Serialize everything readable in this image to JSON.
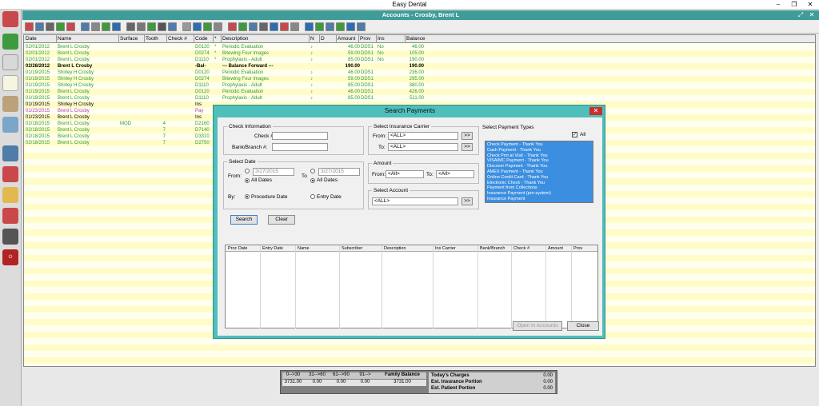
{
  "window": {
    "title": "Easy Dental",
    "controls": [
      "–",
      "❐",
      "✕"
    ]
  },
  "subwindow": {
    "title": "Accounts - Crosby, Brent L",
    "controls": [
      "⤢",
      "✕"
    ]
  },
  "ledger": {
    "columns": [
      "Date",
      "Name",
      "Surface",
      "Tooth",
      "Check #",
      "Code",
      "*",
      "Description",
      "N",
      "D",
      "Amount",
      "Prov",
      "Ins",
      "Balance"
    ],
    "rows": [
      {
        "date": "02/01/2012",
        "name": "Brent L Crosby",
        "surface": "",
        "tooth": "",
        "check": "",
        "code": "D0120",
        "star": "*",
        "desc": "Periodic Evaluation",
        "nd": "♪",
        "amount": "46.00",
        "prov": "DDS1",
        "ins": "No",
        "balance": "46.00",
        "color": "#2d9a3c"
      },
      {
        "date": "02/01/2012",
        "name": "Brent L Crosby",
        "surface": "",
        "tooth": "",
        "check": "",
        "code": "D0274",
        "star": "*",
        "desc": "Bitewing Four Images",
        "nd": "♪",
        "amount": "59.00",
        "prov": "DDS1",
        "ins": "No",
        "balance": "105.00",
        "color": "#2d9a3c"
      },
      {
        "date": "02/01/2012",
        "name": "Brent L Crosby",
        "surface": "",
        "tooth": "",
        "check": "",
        "code": "D1110",
        "star": "*",
        "desc": "Prophylaxis - Adult",
        "nd": "♪",
        "amount": "85.00",
        "prov": "DDS1",
        "ins": "No",
        "balance": "190.00",
        "color": "#2d9a3c"
      },
      {
        "date": "02/28/2012",
        "name": "Brent L Crosby",
        "surface": "",
        "tooth": "",
        "check": "",
        "code": "-Bal-",
        "star": "",
        "desc": "--- Balance Forward ---",
        "nd": "",
        "amount": "190.00",
        "prov": "",
        "ins": "",
        "balance": "190.00",
        "color": "#000000"
      },
      {
        "date": "01/19/2015",
        "name": "Shirley H Crosby",
        "surface": "",
        "tooth": "",
        "check": "",
        "code": "D0120",
        "star": "",
        "desc": "Periodic Evaluation",
        "nd": "♪",
        "amount": "46.00",
        "prov": "DDS1",
        "ins": "",
        "balance": "236.00",
        "color": "#2d9a3c"
      },
      {
        "date": "01/19/2015",
        "name": "Shirley H Crosby",
        "surface": "",
        "tooth": "",
        "check": "",
        "code": "D0274",
        "star": "",
        "desc": "Bitewing Four Images",
        "nd": "♪",
        "amount": "59.00",
        "prov": "DDS1",
        "ins": "",
        "balance": "295.00",
        "color": "#2d9a3c"
      },
      {
        "date": "01/19/2015",
        "name": "Shirley H Crosby",
        "surface": "",
        "tooth": "",
        "check": "",
        "code": "D1110",
        "star": "",
        "desc": "Prophylaxis - Adult",
        "nd": "♪",
        "amount": "85.00",
        "prov": "DDS1",
        "ins": "",
        "balance": "380.00",
        "color": "#2d9a3c"
      },
      {
        "date": "01/19/2015",
        "name": "Brent L Crosby",
        "surface": "",
        "tooth": "",
        "check": "",
        "code": "D0120",
        "star": "",
        "desc": "Periodic Evaluation",
        "nd": "♪",
        "amount": "46.00",
        "prov": "DDS1",
        "ins": "",
        "balance": "426.00",
        "color": "#2d9a3c"
      },
      {
        "date": "01/19/2015",
        "name": "Brent L Crosby",
        "surface": "",
        "tooth": "",
        "check": "",
        "code": "D1110",
        "star": "",
        "desc": "Prophylaxis - Adult",
        "nd": "♪",
        "amount": "85.00",
        "prov": "DDS1",
        "ins": "",
        "balance": "511.00",
        "color": "#2d9a3c"
      },
      {
        "date": "01/19/2015",
        "name": "Shirley H Crosby",
        "surface": "",
        "tooth": "",
        "check": "",
        "code": "Ins",
        "star": "",
        "desc": "",
        "nd": "",
        "amount": "",
        "prov": "",
        "ins": "",
        "balance": "",
        "color": "#000000"
      },
      {
        "date": "01/23/2015",
        "name": "Brent L Crosby",
        "surface": "",
        "tooth": "",
        "check": "",
        "code": "Pay",
        "star": "",
        "desc": "",
        "nd": "",
        "amount": "",
        "prov": "",
        "ins": "",
        "balance": "",
        "color": "#b23cc1"
      },
      {
        "date": "01/23/2015",
        "name": "Brent L Crosby",
        "surface": "",
        "tooth": "",
        "check": "",
        "code": "Ins",
        "star": "",
        "desc": "",
        "nd": "",
        "amount": "",
        "prov": "",
        "ins": "",
        "balance": "",
        "color": "#000000"
      },
      {
        "date": "02/18/2015",
        "name": "Brent L Crosby",
        "surface": "MOD",
        "tooth": "4",
        "check": "",
        "code": "D2160",
        "star": "",
        "desc": "",
        "nd": "",
        "amount": "",
        "prov": "",
        "ins": "",
        "balance": "",
        "color": "#2d9a3c"
      },
      {
        "date": "02/18/2015",
        "name": "Brent L Crosby",
        "surface": "",
        "tooth": "7",
        "check": "",
        "code": "D7140",
        "star": "",
        "desc": "",
        "nd": "",
        "amount": "",
        "prov": "",
        "ins": "",
        "balance": "",
        "color": "#2d9a3c"
      },
      {
        "date": "02/18/2015",
        "name": "Brent L Crosby",
        "surface": "",
        "tooth": "7",
        "check": "",
        "code": "D3310",
        "star": "",
        "desc": "",
        "nd": "",
        "amount": "",
        "prov": "",
        "ins": "",
        "balance": "",
        "color": "#2d9a3c"
      },
      {
        "date": "02/18/2015",
        "name": "Brent L Crosby",
        "surface": "",
        "tooth": "7",
        "check": "",
        "code": "D2750",
        "star": "",
        "desc": "",
        "nd": "",
        "amount": "",
        "prov": "",
        "ins": "",
        "balance": "",
        "color": "#2d9a3c"
      }
    ]
  },
  "dialog": {
    "title": "Search Payments",
    "close": "✕",
    "check_info": {
      "title": "Check Information",
      "check_label": "Check #:",
      "check_value": "",
      "bank_label": "Bank/Branch #:",
      "bank_value": ""
    },
    "insurance": {
      "title": "Select Insurance Carrier",
      "from_label": "From:",
      "from_value": "<ALL>",
      "to_label": "To:",
      "to_value": "<ALL>",
      "more": ">>"
    },
    "payment_types": {
      "title": "Select Payment Types",
      "all_label": "All",
      "all_checked": "✓",
      "items": [
        "Check Payment - Thank You",
        "Cash Payment - Thank You",
        "Check Pmt at Visit - Thank You",
        "VISA/MC Payment - Thank You",
        "Discover Payment - Thank You",
        "AMEX Payment - Thank You",
        "Online Credit Card - Thank You",
        "Electronic Check - Thank You",
        "Payment from Collections",
        "Insurance Payment (pre-system)",
        "Insurance Payment"
      ]
    },
    "date": {
      "title": "Select Date",
      "from_label": "From:",
      "to_label": "To",
      "from_value": "3/27/2015",
      "to_value": "3/27/2015",
      "all_dates": "All Dates",
      "by_label": "By:",
      "procedure_date": "Procedure Date",
      "entry_date": "Entry Date"
    },
    "amount": {
      "title": "Amount",
      "from_label": "From:",
      "from_value": "<All>",
      "to_label": "To:",
      "to_value": "<All>"
    },
    "account": {
      "title": "Select Account",
      "value": "<ALL>",
      "more": ">>"
    },
    "search_label": "Search",
    "clear_label": "Clear",
    "results_columns": [
      "Proc Date",
      "Entry Date",
      "Name",
      "Subscriber",
      "Description",
      "Ins Carrier",
      "Bank/Branch",
      "Check #",
      "Amount",
      "Prov"
    ],
    "open_accounts_label": "Open In Accounts",
    "close_label": "Close"
  },
  "summary": {
    "aging_headers": [
      "0-->30",
      "31-->60",
      "61-->90",
      "91-->",
      "Family Balance"
    ],
    "aging_values": [
      "3731.00",
      "0.00",
      "0.00",
      "0.00",
      "3731.00"
    ],
    "labels": [
      "Today's Charges",
      "Est. Insurance Portion",
      "Est. Patient Portion"
    ],
    "values": [
      "0.00",
      "0.00",
      "0.00"
    ]
  },
  "colors": {
    "teal": "#3f9c99",
    "dialog_border": "#4fbfbc",
    "highlight": "#3c8fe0",
    "row_alt": "#fffcc8"
  }
}
